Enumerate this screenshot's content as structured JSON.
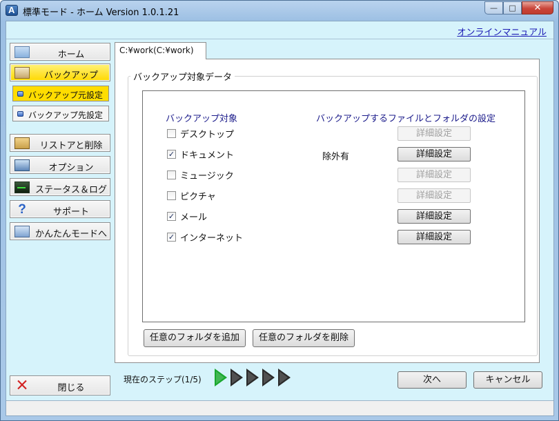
{
  "window": {
    "title": "標準モード - ホーム   Version 1.0.1.21",
    "minimize_label": "—",
    "maximize_label": "□",
    "close_label": "✕"
  },
  "header": {
    "manual_link": "オンラインマニュアル"
  },
  "sidebar": {
    "home": "ホーム",
    "backup": "バックアップ",
    "backup_source": "バックアップ元設定",
    "backup_destination": "バックアップ先設定",
    "restore_delete": "リストアと削除",
    "options": "オプション",
    "status_log": "ステータス＆ログ",
    "support": "サポート",
    "support_icon_glyph": "?",
    "easy_mode": "かんたんモードへ",
    "close": "閉じる"
  },
  "tab": {
    "label": "C:¥work(C:¥work)"
  },
  "group": {
    "title": "バックアップ対象データ",
    "col_target": "バックアップ対象",
    "col_settings": "バックアップするファイルとフォルダの設定",
    "items": [
      {
        "label": "デスクトップ",
        "checked": false,
        "mark": "",
        "note": "",
        "button": "詳細設定",
        "enabled": false
      },
      {
        "label": "ドキュメント",
        "checked": true,
        "mark": "✓",
        "note": "除外有",
        "button": "詳細設定",
        "enabled": true
      },
      {
        "label": "ミュージック",
        "checked": false,
        "mark": "",
        "note": "",
        "button": "詳細設定",
        "enabled": false
      },
      {
        "label": "ピクチャ",
        "checked": false,
        "mark": "",
        "note": "",
        "button": "詳細設定",
        "enabled": false
      },
      {
        "label": "メール",
        "checked": true,
        "mark": "✓",
        "note": "",
        "button": "詳細設定",
        "enabled": true
      },
      {
        "label": "インターネット",
        "checked": true,
        "mark": "✓",
        "note": "",
        "button": "詳細設定",
        "enabled": true
      }
    ]
  },
  "buttons": {
    "add_folder": "任意のフォルダを追加",
    "remove_folder": "任意のフォルダを削除",
    "next": "次へ",
    "cancel": "キャンセル"
  },
  "steps": {
    "label": "現在のステップ(1/5)",
    "current": 1,
    "total": 5
  },
  "colors": {
    "client_bg": "#d6f3fb",
    "active_nav": "#ffd800",
    "step_active": "#19a82e",
    "step_inactive": "#2a2a2a",
    "link": "#1a1ab4"
  }
}
